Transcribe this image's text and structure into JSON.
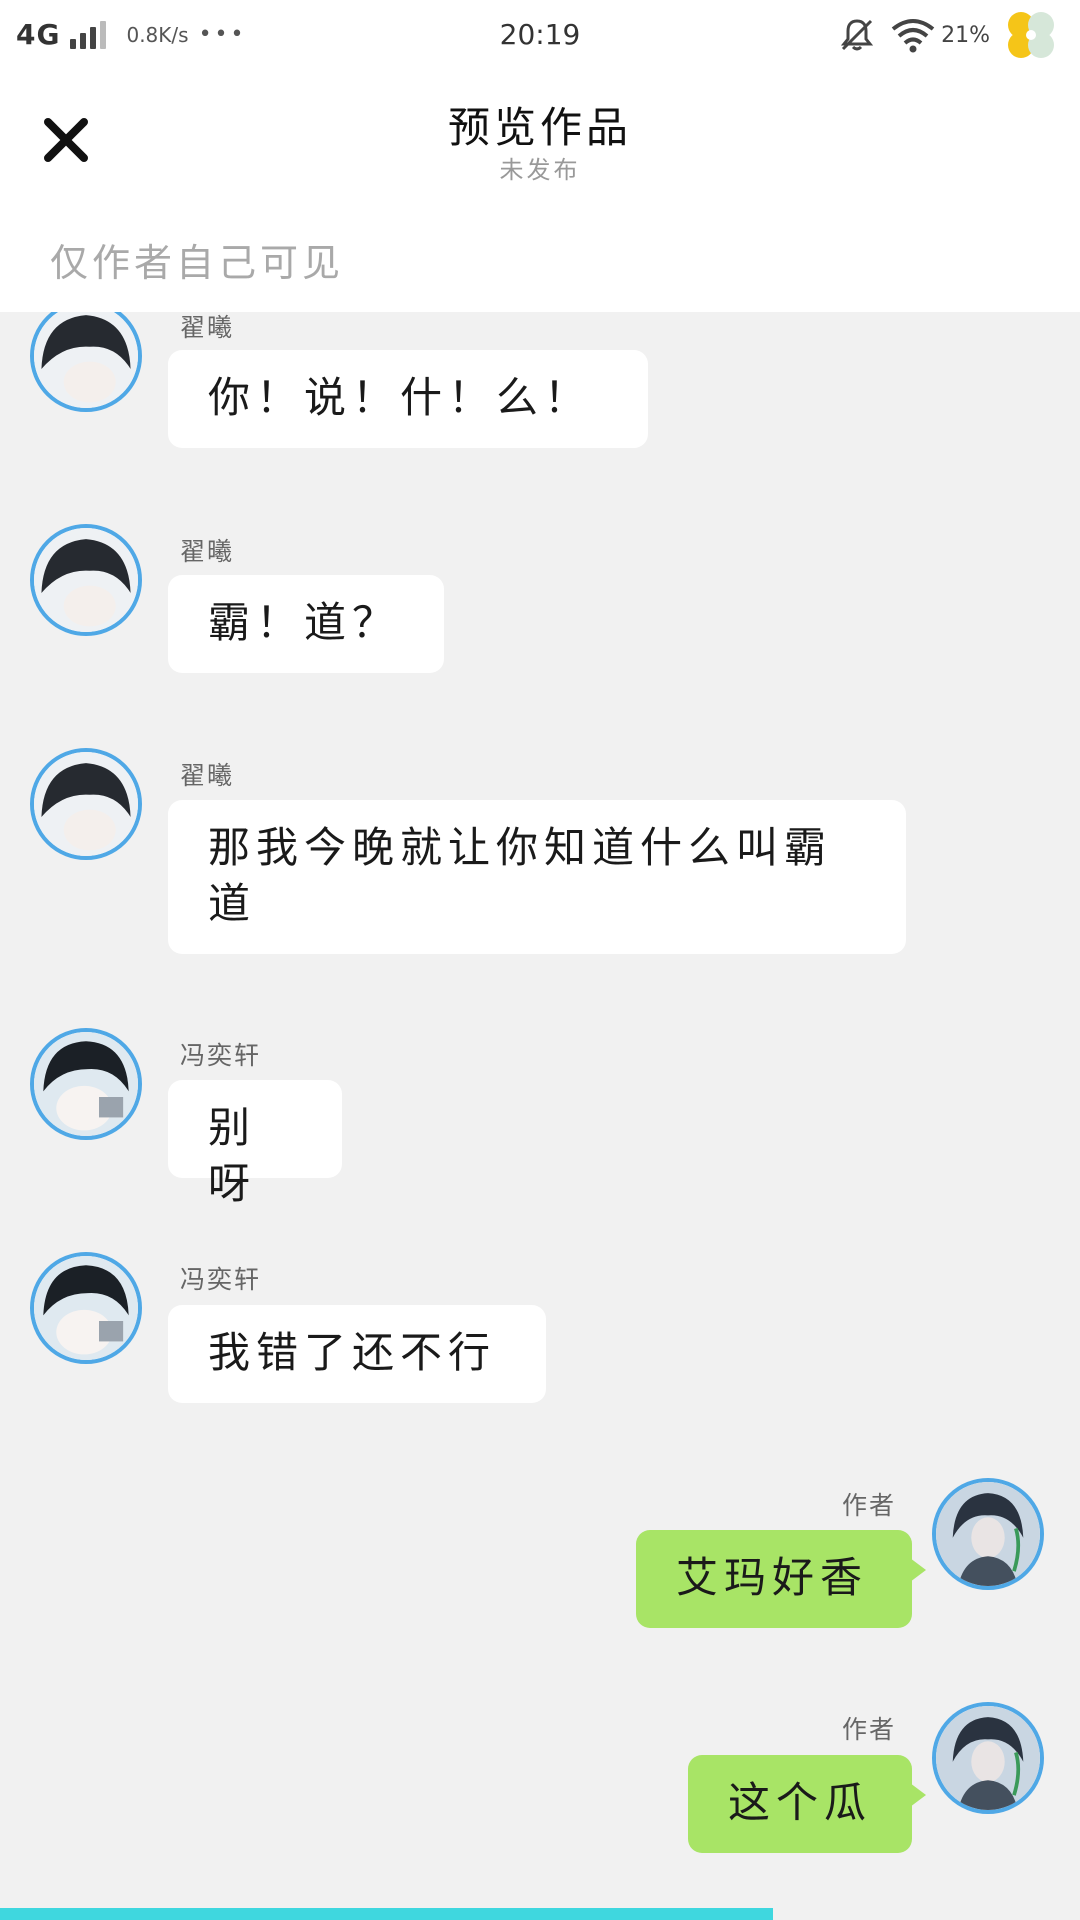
{
  "status_bar": {
    "network": "4G",
    "speed": "0.8K/s",
    "more": "•••",
    "time": "20:19",
    "battery": "21%"
  },
  "header": {
    "title": "预览作品",
    "subtitle": "未发布",
    "visibility_note": "仅作者自己可见"
  },
  "messages": [
    {
      "side": "left",
      "sender": "翟曦",
      "text": "你！说！什！么！"
    },
    {
      "side": "left",
      "sender": "翟曦",
      "text": "霸！道？"
    },
    {
      "side": "left",
      "sender": "翟曦",
      "text": "那我今晚就让你知道什么叫霸道"
    },
    {
      "side": "left",
      "sender": "冯奕轩",
      "text": "别呀"
    },
    {
      "side": "left",
      "sender": "冯奕轩",
      "text": "我错了还不行"
    },
    {
      "side": "right",
      "sender": "作者",
      "text": "艾玛好香"
    },
    {
      "side": "right",
      "sender": "作者",
      "text": "这个瓜"
    }
  ],
  "progress": {
    "fraction": 0.716
  },
  "colors": {
    "avatar_ring": "#4fa8e6",
    "right_bubble": "#a8e466",
    "left_bubble": "#ffffff",
    "progress": "#3fd7df"
  },
  "icons": [
    "close-icon",
    "signal-icon",
    "mute-icon",
    "wifi-icon",
    "clover-icon"
  ]
}
